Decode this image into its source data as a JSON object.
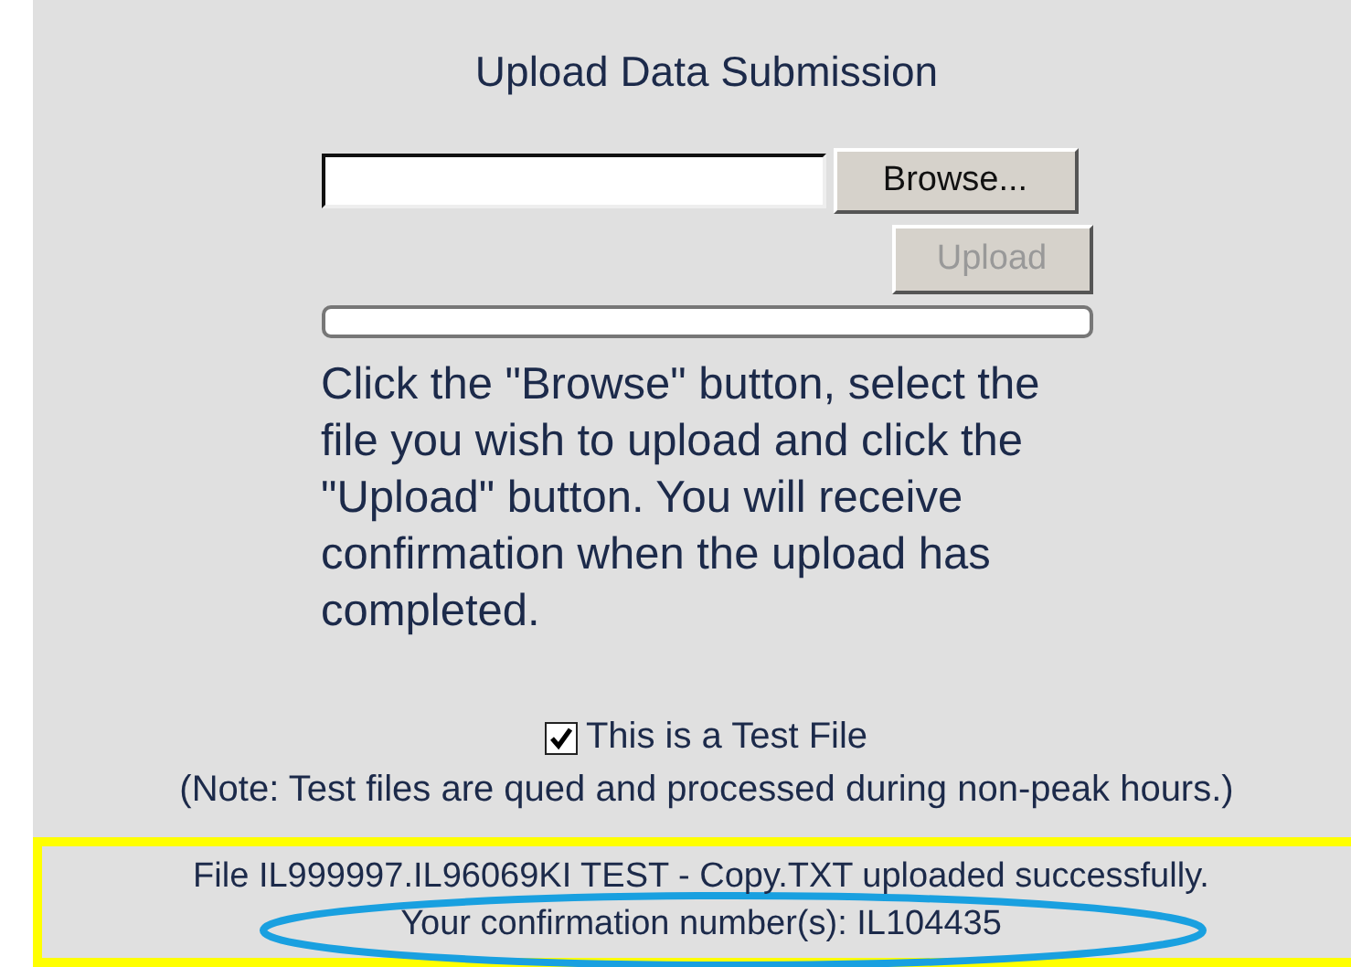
{
  "title": "Upload Data Submission",
  "browse_button": {
    "label": "Browse...",
    "disabled": false
  },
  "upload_button": {
    "label": "Upload",
    "disabled": true
  },
  "instructions": "Click the \"Browse\" button, select the file you wish to upload and click the \"Upload\" button. You will receive confirmation when the upload has completed.",
  "test_file": {
    "label": "This is a Test File",
    "checked": true
  },
  "note": "(Note: Test files are qued and processed during non-peak hours.)",
  "result": {
    "message": "File IL999997.IL96069KI TEST - Copy.TXT uploaded successfully.",
    "confirmation": "Your confirmation number(s): IL104435",
    "circled": true
  }
}
